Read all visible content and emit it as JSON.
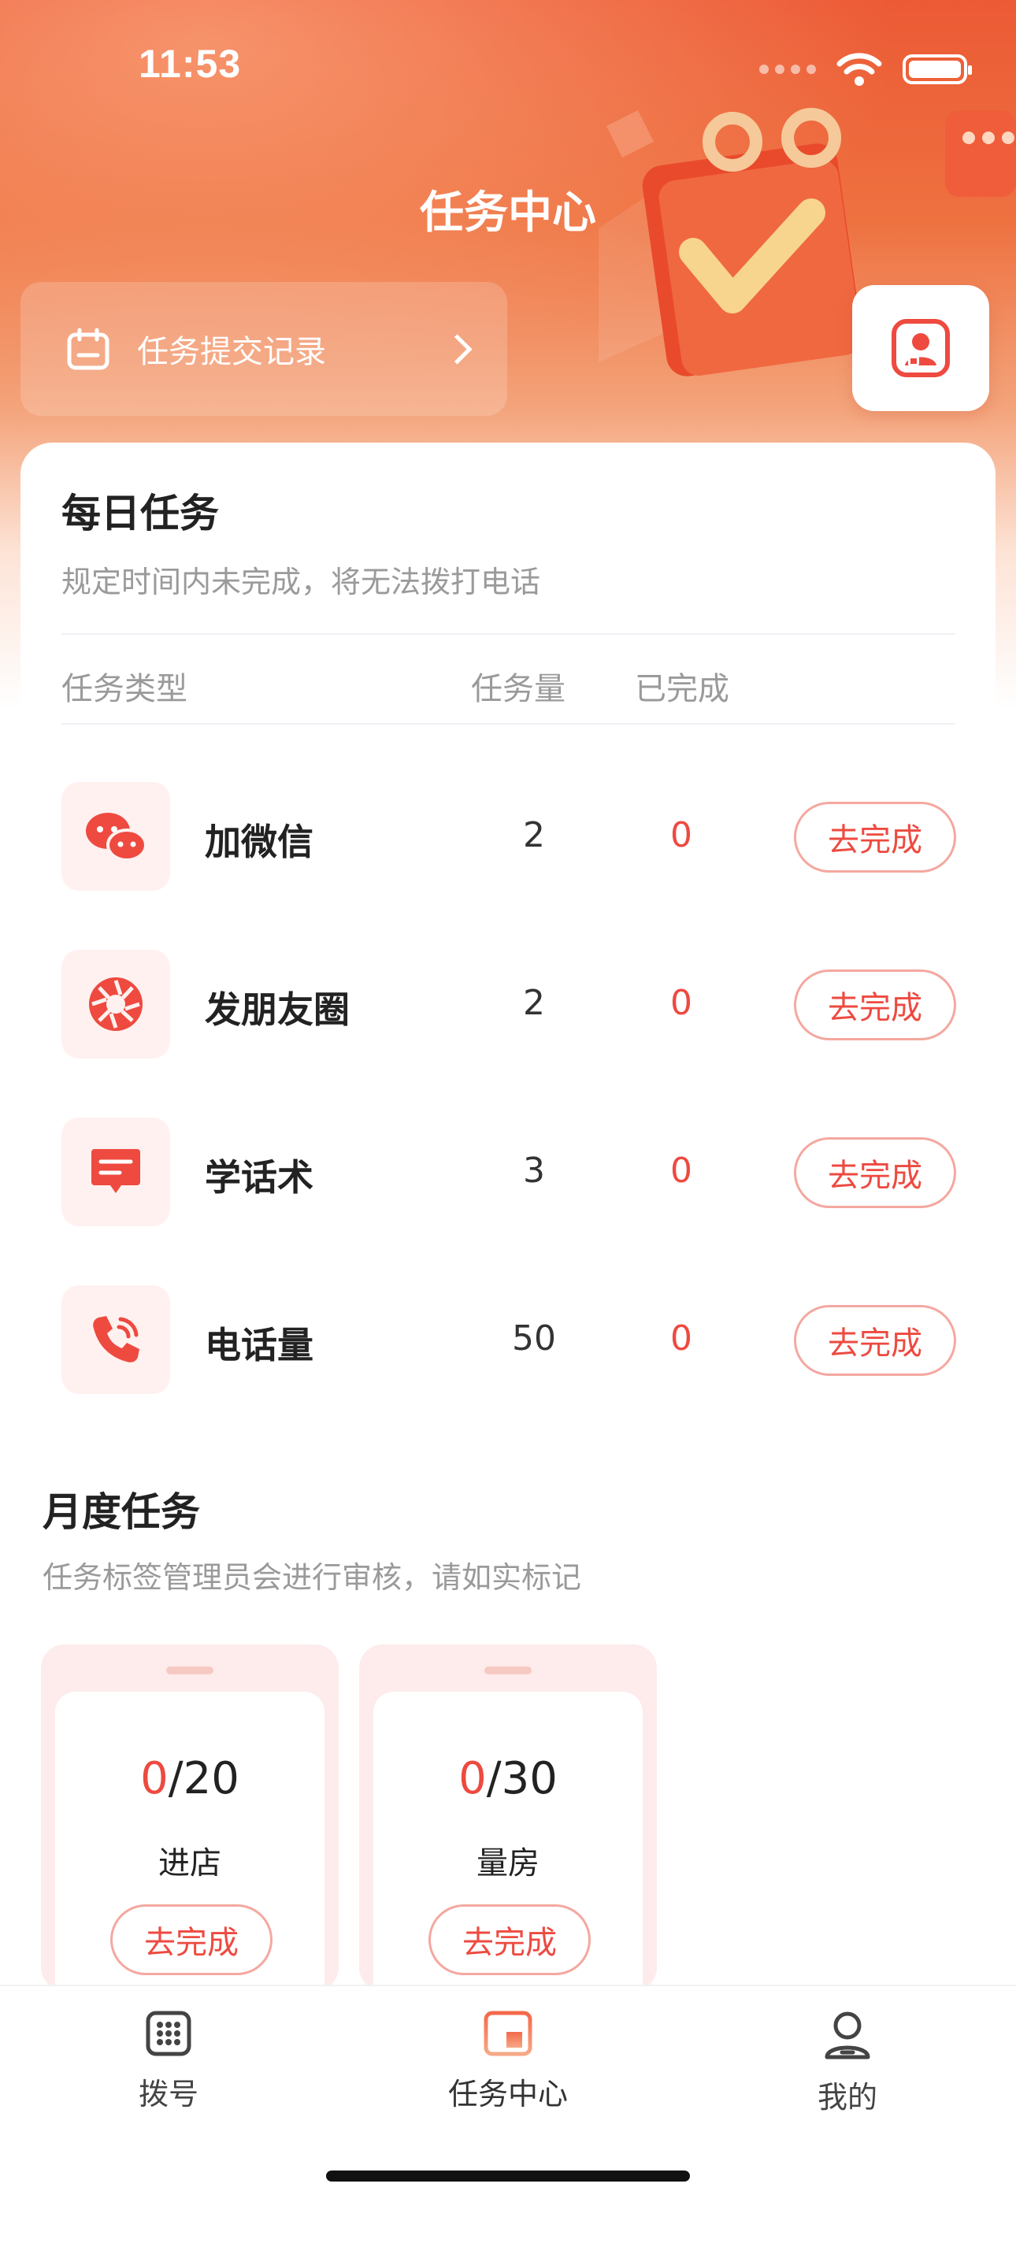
{
  "status_bar": {
    "time": "11:53"
  },
  "header": {
    "title": "任务中心",
    "record_link_label": "任务提交记录"
  },
  "daily": {
    "title": "每日任务",
    "subtitle": "规定时间内未完成，将无法拨打电话",
    "columns": {
      "type": "任务类型",
      "quantity": "任务量",
      "completed": "已完成"
    },
    "rows": [
      {
        "icon": "wechat-icon",
        "name": "加微信",
        "quantity": "2",
        "completed": "0",
        "action": "去完成"
      },
      {
        "icon": "moments-icon",
        "name": "发朋友圈",
        "quantity": "2",
        "completed": "0",
        "action": "去完成"
      },
      {
        "icon": "script-icon",
        "name": "学话术",
        "quantity": "3",
        "completed": "0",
        "action": "去完成"
      },
      {
        "icon": "phone-icon",
        "name": "电话量",
        "quantity": "50",
        "completed": "0",
        "action": "去完成"
      }
    ]
  },
  "monthly": {
    "title": "月度任务",
    "subtitle": "任务标签管理员会进行审核，请如实标记",
    "cards": [
      {
        "done": "0",
        "total": "/20",
        "label": "进店",
        "action": "去完成"
      },
      {
        "done": "0",
        "total": "/30",
        "label": "量房",
        "action": "去完成"
      }
    ]
  },
  "tabbar": {
    "items": [
      {
        "label": "拨号",
        "icon": "dialpad-icon",
        "active": false
      },
      {
        "label": "任务中心",
        "icon": "task-center-icon",
        "active": true
      },
      {
        "label": "我的",
        "icon": "profile-icon",
        "active": false
      }
    ]
  },
  "colors": {
    "accent": "#ee4a40",
    "header_top": "#ec5a35",
    "pill_border": "#f4a8a0"
  }
}
